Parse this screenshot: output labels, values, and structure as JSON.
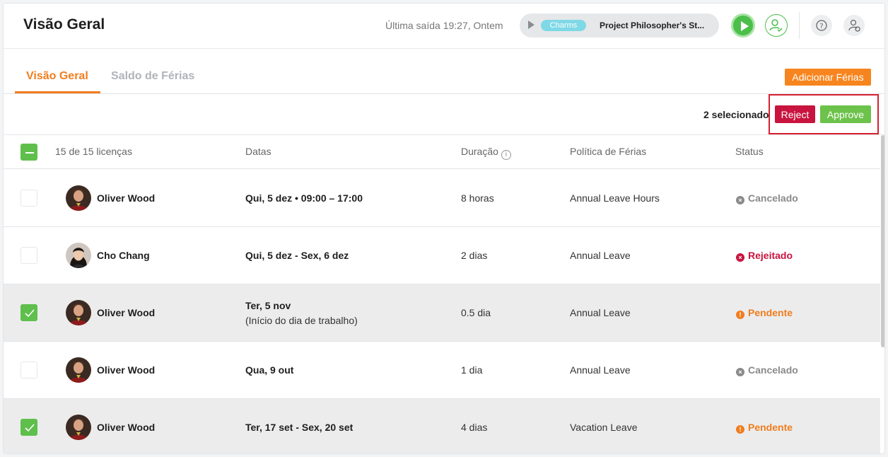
{
  "header": {
    "title": "Visão Geral",
    "last_exit": "Última saída 19:27, Ontem",
    "tracker": {
      "tag": "Charms",
      "project": "Project Philosopher's St..."
    }
  },
  "tabs": [
    {
      "label": "Visão Geral",
      "active": true
    },
    {
      "label": "Saldo de Férias",
      "active": false
    }
  ],
  "add_button": "Adicionar Férias",
  "selection": {
    "count_label": "2 selecionado",
    "reject": "Reject",
    "approve": "Approve"
  },
  "table": {
    "headers": {
      "count": "15 de 15 licenças",
      "dates": "Datas",
      "duration": "Duração",
      "policy": "Política de Férias",
      "status": "Status"
    },
    "rows": [
      {
        "selected": false,
        "name": "Oliver Wood",
        "dates": "Qui, 5 dez • 09:00 – 17:00",
        "dates_sub": "",
        "duration": "8 horas",
        "policy": "Annual Leave Hours",
        "status": "Cancelado",
        "status_type": "cancel",
        "avatar": "oliver"
      },
      {
        "selected": false,
        "name": "Cho Chang",
        "dates": "Qui, 5 dez - Sex, 6 dez",
        "dates_sub": "",
        "duration": "2 dias",
        "policy": "Annual Leave",
        "status": "Rejeitado",
        "status_type": "reject",
        "avatar": "cho"
      },
      {
        "selected": true,
        "name": "Oliver Wood",
        "dates": "Ter, 5 nov",
        "dates_sub": "(Início do dia de trabalho)",
        "duration": "0.5 dia",
        "policy": "Annual Leave",
        "status": "Pendente",
        "status_type": "pend",
        "avatar": "oliver"
      },
      {
        "selected": false,
        "name": "Oliver Wood",
        "dates": "Qua, 9 out",
        "dates_sub": "",
        "duration": "1 dia",
        "policy": "Annual Leave",
        "status": "Cancelado",
        "status_type": "cancel",
        "avatar": "oliver"
      },
      {
        "selected": true,
        "name": "Oliver Wood",
        "dates": "Ter, 17 set - Sex, 20 set",
        "dates_sub": "",
        "duration": "4 dias",
        "policy": "Vacation Leave",
        "status": "Pendente",
        "status_type": "pend",
        "avatar": "oliver"
      }
    ]
  },
  "colors": {
    "accent": "#f07d1e",
    "approve": "#6cc24a",
    "reject": "#c8143e",
    "check": "#5fbf4c"
  }
}
